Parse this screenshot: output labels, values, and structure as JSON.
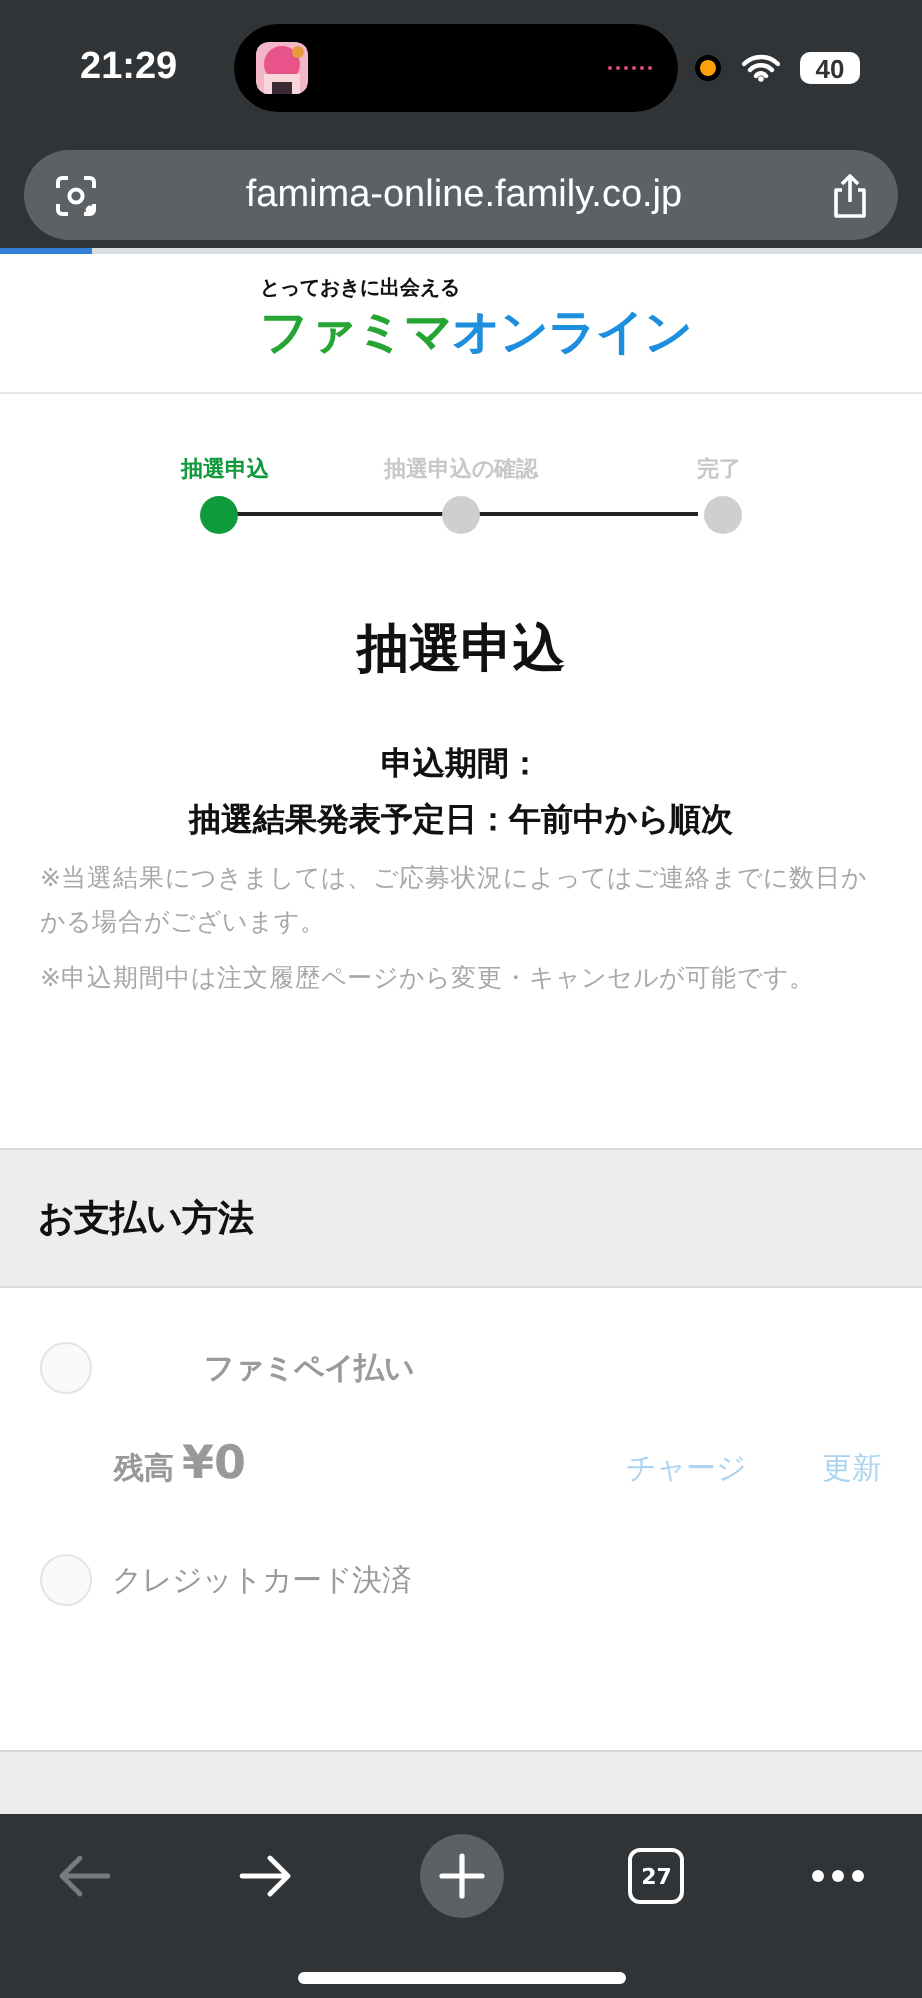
{
  "status_bar": {
    "time": "21:29",
    "battery": "40"
  },
  "address_bar": {
    "url": "famima-online.family.co.jp",
    "load_progress": {
      "level": 0.1
    }
  },
  "logo": {
    "tagline": "とっておきに出会える",
    "brand": "ファミマ",
    "service": "オンライン"
  },
  "steps": [
    {
      "label": "抽選申込",
      "selected": true
    },
    {
      "label": "抽選申込の確認",
      "selected": false
    },
    {
      "label": "完了",
      "selected": false
    }
  ],
  "title": "抽選申込",
  "period_lines": [
    "申込期間：",
    "抽選結果発表予定日：午前中から順次"
  ],
  "notes": [
    "※当選結果につきましては、ご応募状況によってはご連絡までに数日かかる場合がございます。",
    "※申込期間中は注文履歴ページから変更・キャンセルが可能です。"
  ],
  "payment": {
    "heading": "お支払い方法",
    "options": [
      {
        "kind": "wallet",
        "label": "ファミペイ払い",
        "selected": false,
        "disabled": true,
        "balance_label": "残高",
        "balance": "¥0",
        "actions": [
          "チャージ",
          "更新"
        ]
      },
      {
        "kind": "card",
        "label": "クレジットカード決済",
        "selected": false,
        "disabled": true
      }
    ]
  },
  "toolbar": {
    "back_disabled": true,
    "tabs_count": "27"
  }
}
